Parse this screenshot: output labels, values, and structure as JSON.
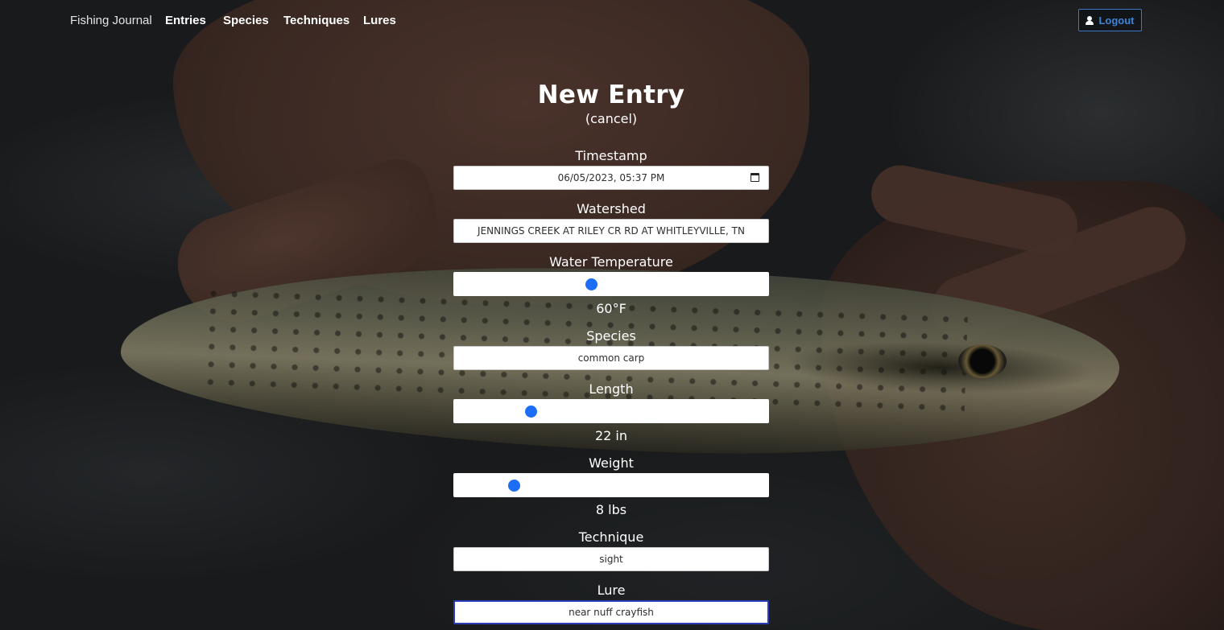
{
  "navbar": {
    "brand": "Fishing Journal",
    "links": [
      "Entries",
      "Species",
      "Techniques",
      "Lures"
    ],
    "logout_label": "Logout"
  },
  "form": {
    "title": "New Entry",
    "cancel_label": "(cancel)",
    "timestamp": {
      "label": "Timestamp",
      "value": "06/05/2023, 05:37 PM"
    },
    "watershed": {
      "label": "Watershed",
      "value": "JENNINGS CREEK AT RILEY CR RD AT WHITLEYVILLE, TN"
    },
    "water_temperature": {
      "label": "Water Temperature",
      "value_text": "60°F",
      "slider_fraction": 0.437
    },
    "species": {
      "label": "Species",
      "value": "common carp"
    },
    "length": {
      "label": "Length",
      "value_text": "22 in",
      "slider_fraction": 0.245
    },
    "weight": {
      "label": "Weight",
      "value_text": "8 lbs",
      "slider_fraction": 0.191
    },
    "technique": {
      "label": "Technique",
      "value": "sight"
    },
    "lure": {
      "label": "Lure",
      "value": "near nuff crayfish"
    }
  },
  "colors": {
    "slider_thumb": "#1b6ef5",
    "logout_accent": "#3d85d8",
    "focus_border": "#2a3cb8"
  },
  "icons": {
    "logout": "user-icon",
    "timestamp": "calendar-icon"
  }
}
